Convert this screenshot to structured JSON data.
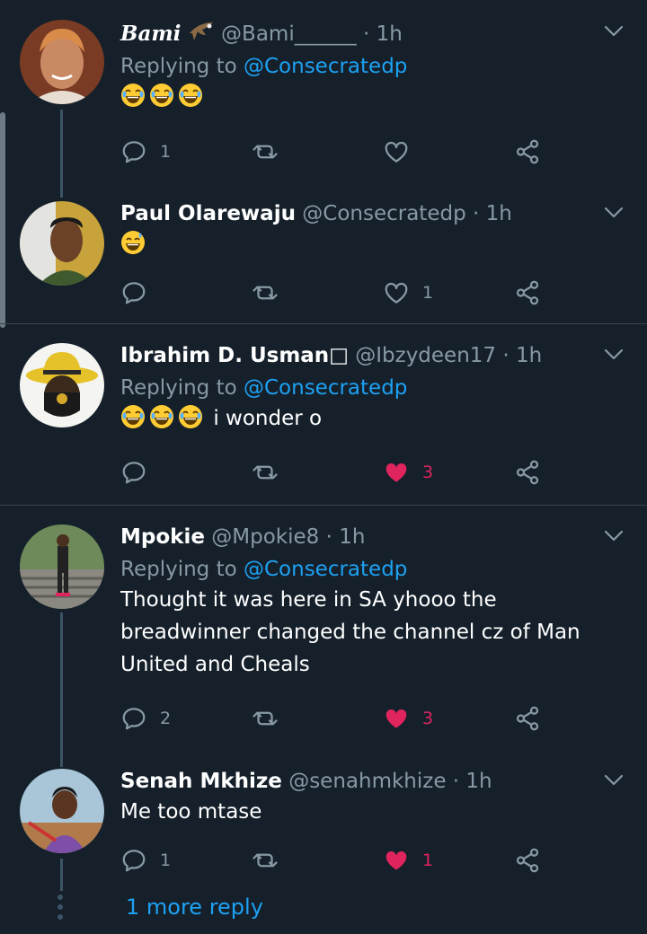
{
  "colors": {
    "background": "#15202b",
    "muted": "#8899a6",
    "accent": "#1da1f2",
    "like": "#e0245e"
  },
  "tweets": [
    {
      "name": "Bami",
      "handle": "@Bami______",
      "dot": "·",
      "time": "1h",
      "replying_prefix": "Replying to",
      "replying_to": "@Consecratedp",
      "emojis": [
        "😂",
        "😂",
        "😂"
      ],
      "text": "",
      "reply_count": "1",
      "like_count": "",
      "liked": false
    },
    {
      "name": "Paul Olarewaju",
      "handle": "@Consecratedp",
      "dot": "·",
      "time": "1h",
      "emojis": [
        "😅"
      ],
      "text": "",
      "reply_count": "",
      "like_count": "1",
      "liked": false
    },
    {
      "name": "Ibrahim D. Usman",
      "name_suffix": "□",
      "handle": "@Ibzydeen17",
      "dot": "·",
      "time": "1h",
      "replying_prefix": "Replying to",
      "replying_to": "@Consecratedp",
      "emojis": [
        "😂",
        "😂",
        "😂"
      ],
      "text": "i wonder o",
      "reply_count": "",
      "like_count": "3",
      "liked": true
    },
    {
      "name": "Mpokie",
      "handle": "@Mpokie8",
      "dot": "·",
      "time": "1h",
      "replying_prefix": "Replying to",
      "replying_to": "@Consecratedp",
      "text_lines": [
        "Thought it was here in SA yhooo the",
        "breadwinner changed the channel cz of Man",
        "United and Cheals"
      ],
      "reply_count": "2",
      "like_count": "3",
      "liked": true
    },
    {
      "name": "Senah Mkhize",
      "handle": "@senahmkhize",
      "dot": "·",
      "time": "1h",
      "text": "Me too mtase",
      "reply_count": "1",
      "like_count": "1",
      "liked": true
    }
  ],
  "more_reply": "1 more reply",
  "icons": [
    "reply-icon",
    "retweet-icon",
    "like-icon",
    "share-icon",
    "chevron-down-icon"
  ]
}
